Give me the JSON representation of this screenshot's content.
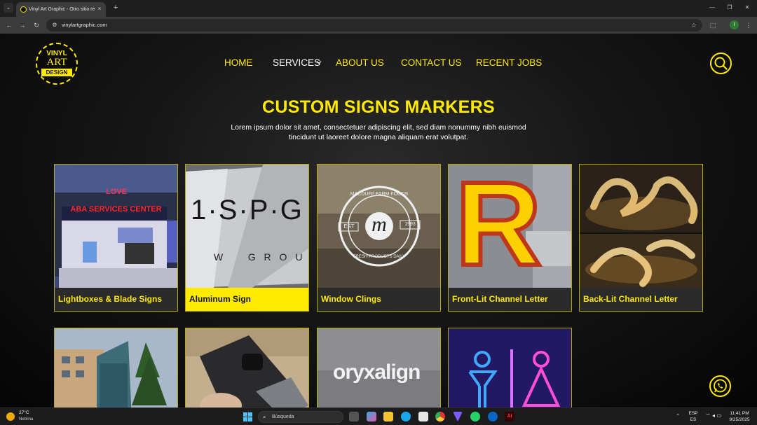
{
  "browser": {
    "tab_title": "Vinyl Art Graphic - Otro sitio realizado con WordPress",
    "url": "vinylartgraphic.com",
    "tab_close": "×",
    "new_tab": "+",
    "profile_initial": "I"
  },
  "logo": {
    "line1": "VINYL",
    "line2": "ART",
    "line3": "DESIGN"
  },
  "nav": {
    "home": "HOME",
    "services": "SERVICES",
    "about": "ABOUT US",
    "contact": "CONTACT US",
    "recent": "RECENT JOBS"
  },
  "hero": {
    "title": "CUSTOM SIGNS MARKERS",
    "subtitle": "Lorem ipsum dolor sit amet, consectetuer adipiscing elit, sed diam nonummy nibh euismod tincidunt ut laoreet dolore magna aliquam erat volutpat."
  },
  "cards": [
    {
      "label": "Lightboxes & Blade Signs",
      "img_text1": "ABA SERVICES CENTER",
      "img_text2": "LOVE"
    },
    {
      "label": "Aluminum Sign",
      "img_text1": "1·S·P·G",
      "img_text2": "W    G R O U"
    },
    {
      "label": "Window Clings",
      "img_text1": "MACDUFF FARM FOODS",
      "img_text2": "FRESH PRODUCTS DAILY",
      "img_text3": "m",
      "img_text4": "EST",
      "img_text5": "1993"
    },
    {
      "label": "Front-Lit Channel Letter",
      "img_text1": "R"
    },
    {
      "label": "Back-Lit Channel Letter"
    }
  ],
  "cards_row2": [
    {
      "name": "building-monument-sign"
    },
    {
      "name": "acrylic-cutout"
    },
    {
      "name": "oryxalign-sign",
      "img_text1": "oryxalign"
    },
    {
      "name": "neon-restroom-sign"
    }
  ],
  "taskbar": {
    "temp": "27°C",
    "weather": "Neblina",
    "search": "Búsqueda",
    "lang1": "ESP",
    "lang2": "ES",
    "time": "11:41 PM",
    "date": "9/25/2025"
  },
  "colors": {
    "accent": "#ffea00",
    "bg": "#0a0a0a"
  }
}
